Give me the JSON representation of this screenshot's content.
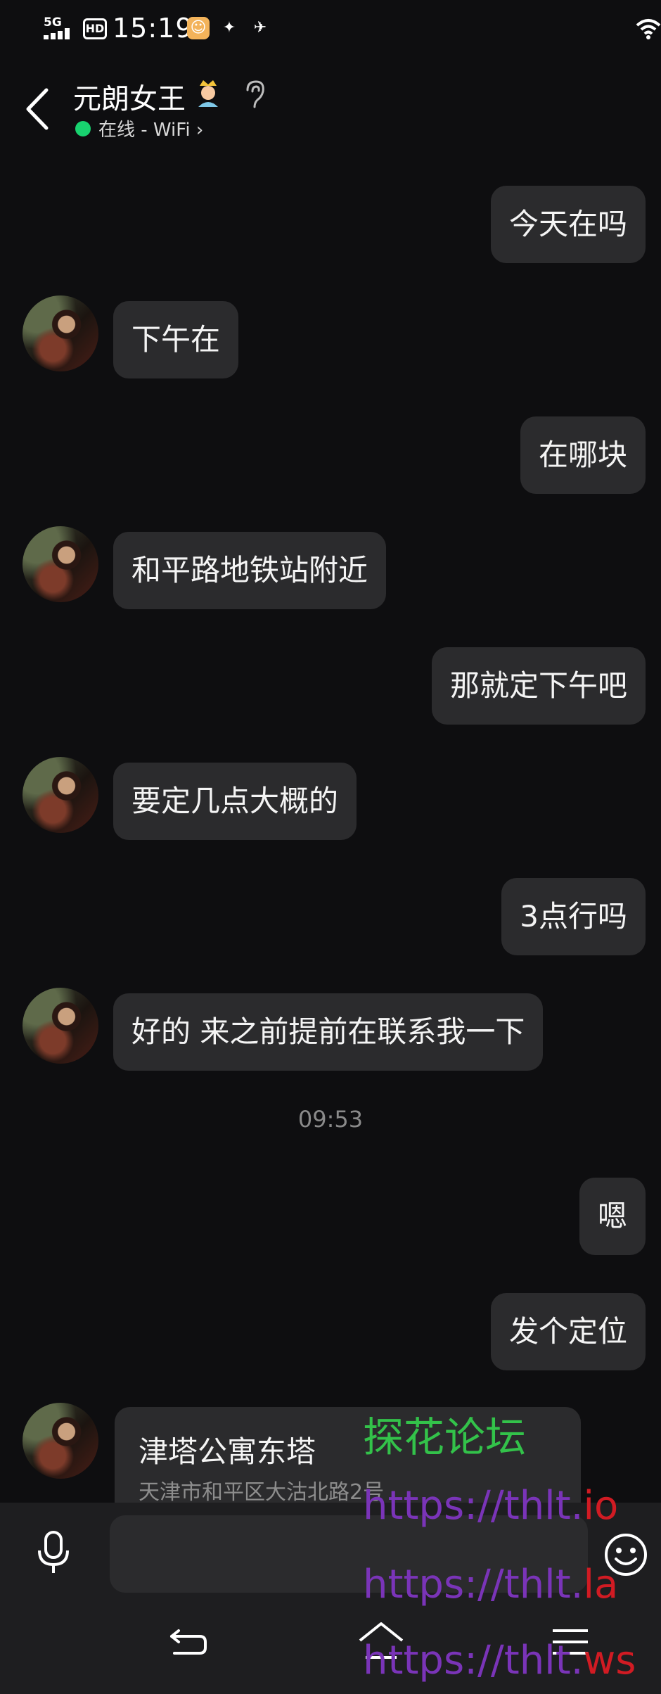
{
  "status_bar": {
    "network": "5G",
    "hd_badge": "HD",
    "time": "15:19",
    "app_icons": [
      "sun-face-app-icon",
      "game-controller-app-icon",
      "paw-app-icon"
    ]
  },
  "header": {
    "name": "元朗女王",
    "status": "在线 - WiFi",
    "status_color": "#18d26f"
  },
  "messages": [
    {
      "side": "right",
      "text": "今天在吗"
    },
    {
      "side": "left",
      "text": "下午在"
    },
    {
      "side": "right",
      "text": "在哪块"
    },
    {
      "side": "left",
      "text": "和平路地铁站附近"
    },
    {
      "side": "right",
      "text": "那就定下午吧"
    },
    {
      "side": "left",
      "text": "要定几点大概的"
    },
    {
      "side": "right",
      "text": "3点行吗"
    },
    {
      "side": "left",
      "text": "好的 来之前提前在联系我一下"
    },
    {
      "side": "right",
      "text": "嗯"
    },
    {
      "side": "right",
      "text": "发个定位"
    }
  ],
  "timestamp": "09:53",
  "location_card": {
    "title": "津塔公寓东塔",
    "address": "天津市和平区大沽北路2号"
  },
  "input": {
    "placeholder": ""
  },
  "watermark": {
    "title": "探花论坛",
    "urls": [
      {
        "head": "https://thlt.",
        "tail": "io"
      },
      {
        "head": "https://thlt.",
        "tail": "la"
      },
      {
        "head": "https://thlt.",
        "tail": "ws"
      }
    ]
  }
}
